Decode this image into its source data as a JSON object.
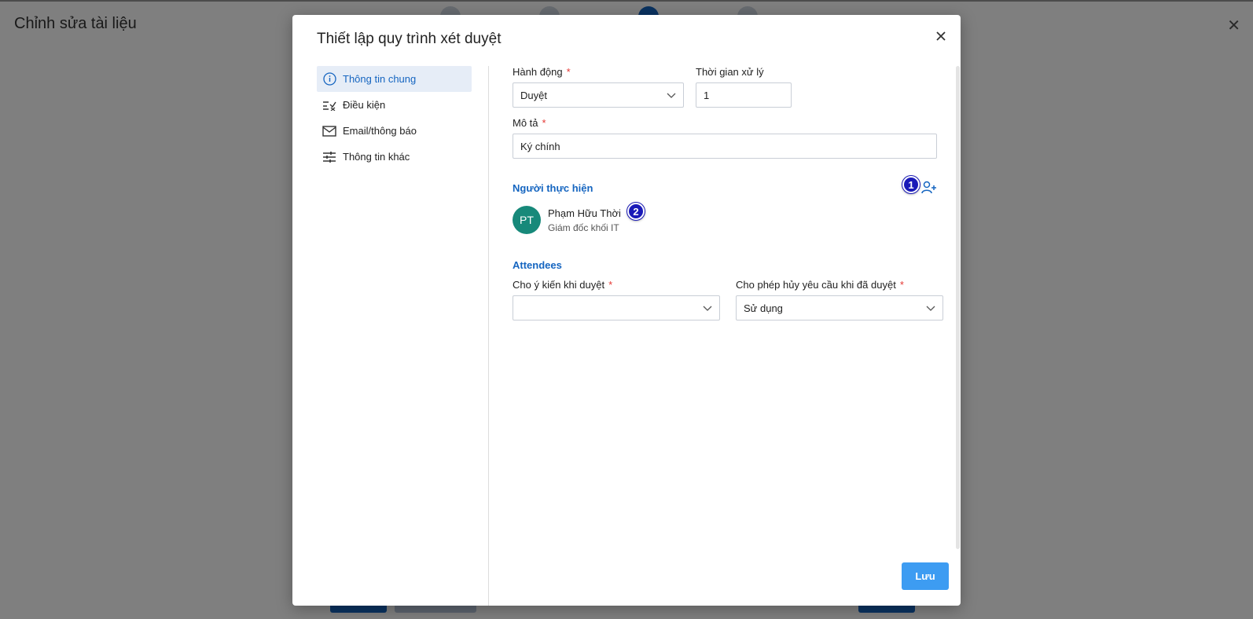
{
  "background": {
    "title": "Chỉnh sửa tài liệu",
    "close_icon": "close-icon"
  },
  "modal": {
    "title": "Thiết lập quy trình xét duyệt",
    "close_icon": "close-icon"
  },
  "sidebar": {
    "items": [
      {
        "label": "Thông tin chung",
        "icon": "info-icon",
        "active": true
      },
      {
        "label": "Điều kiện",
        "icon": "checklist-icon",
        "active": false
      },
      {
        "label": "Email/thông báo",
        "icon": "mail-icon",
        "active": false
      },
      {
        "label": "Thông tin khác",
        "icon": "sliders-icon",
        "active": false
      }
    ]
  },
  "form": {
    "action": {
      "label": "Hành động",
      "required_mark": "*",
      "value": "Duyệt"
    },
    "processing_time": {
      "label": "Thời gian xử lý",
      "value": "1"
    },
    "description": {
      "label": "Mô tả",
      "required_mark": "*",
      "value": "Ký chính"
    },
    "executors": {
      "title": "Người thực hiện",
      "add_icon": "add-user-icon",
      "badge_1": "1",
      "badge_2": "2",
      "people": [
        {
          "initials": "PT",
          "name": "Phạm Hữu Thời",
          "role": "Giám đốc khối IT"
        }
      ]
    },
    "attendees": {
      "title": "Attendees"
    },
    "comment_on_approve": {
      "label": "Cho ý kiến khi duyệt",
      "required_mark": "*",
      "value": ""
    },
    "allow_cancel": {
      "label": "Cho phép hủy yêu cầu khi đã duyệt",
      "required_mark": "*",
      "value": "Sử dụng"
    }
  },
  "footer": {
    "save_label": "Lưu"
  },
  "colors": {
    "accent": "#1565c0",
    "avatar": "#17897a",
    "save_button": "#3d9cf2",
    "required": "#e53935"
  }
}
